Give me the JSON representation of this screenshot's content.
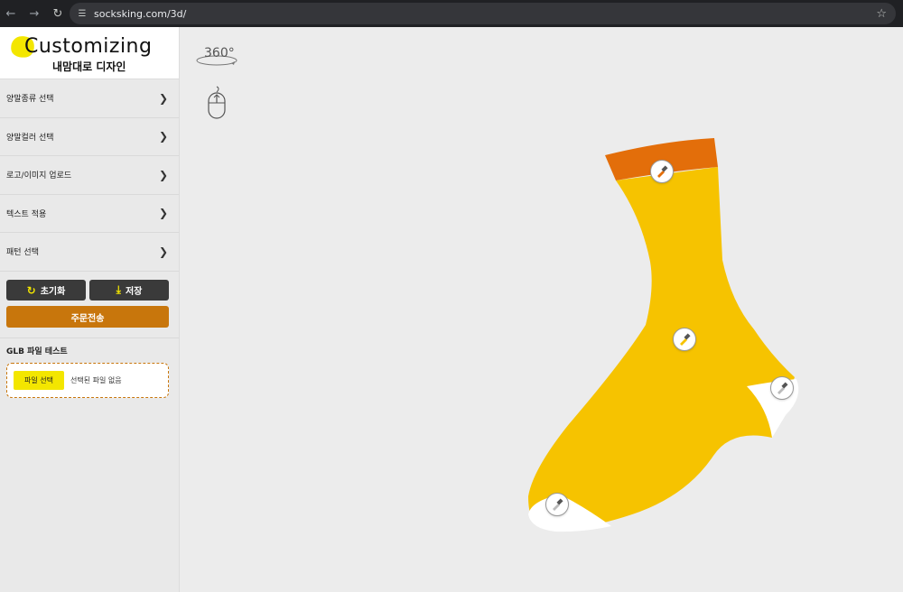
{
  "browser": {
    "url": "socksking.com/3d/",
    "icons": [
      "back-arrow-icon",
      "forward-arrow-icon",
      "reload-icon",
      "site-info-icon",
      "bookmark-star-icon"
    ]
  },
  "logo": {
    "title": "Customizing",
    "subtitle": "내맘대로 디자인"
  },
  "menu": [
    {
      "label": "양말종류 선택"
    },
    {
      "label": "양말컬러 선택"
    },
    {
      "label": "로고/이미지 업로드"
    },
    {
      "label": "텍스트 적용"
    },
    {
      "label": "패턴 선택"
    }
  ],
  "actions": {
    "reset_label": "초기화",
    "save_label": "저장",
    "order_label": "주문전송"
  },
  "glb": {
    "heading": "GLB 파일 테스트",
    "file_button": "파일 선택",
    "file_status": "선택된 파일 없음"
  },
  "viewer": {
    "rotate_label": "360°",
    "sock_colors": {
      "body": "#f6c300",
      "cuff": "#e36e0a",
      "heel_toe": "#ffffff"
    },
    "hotspots": [
      "cuff-hotspot",
      "body-hotspot",
      "heel-hotspot",
      "toe-hotspot"
    ]
  }
}
